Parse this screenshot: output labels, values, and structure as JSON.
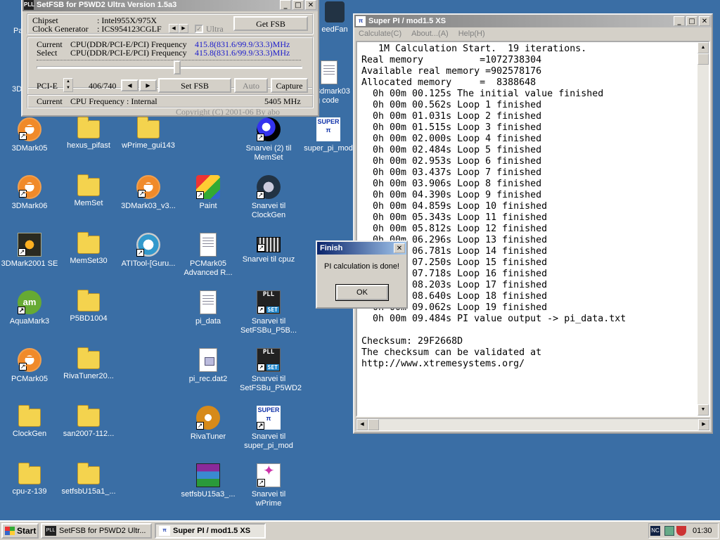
{
  "desktop": {
    "icons": [
      {
        "id": "3dmark05",
        "label": "3DMark05"
      },
      {
        "id": "hexus_pifast",
        "label": "hexus_pifast"
      },
      {
        "id": "wprime_gui143",
        "label": "wPrime_gui143"
      },
      {
        "id": "snarvei_memset",
        "label": "Snarvei (2) til MemSet"
      },
      {
        "id": "super_pi_mod",
        "label": "super_pi_mod"
      },
      {
        "id": "3dmark06",
        "label": "3DMark06"
      },
      {
        "id": "memset",
        "label": "MemSet"
      },
      {
        "id": "3dmark03_v3",
        "label": "3DMark03_v3..."
      },
      {
        "id": "paint",
        "label": "Paint"
      },
      {
        "id": "snarvei_clockgen",
        "label": "Snarvei til ClockGen"
      },
      {
        "id": "3dmark2001se",
        "label": "3DMark2001 SE"
      },
      {
        "id": "memset30",
        "label": "MemSet30"
      },
      {
        "id": "atitool",
        "label": "ATITool-[Guru..."
      },
      {
        "id": "pcmark05_adv",
        "label": "PCMark05 Advanced R..."
      },
      {
        "id": "snarvei_cpuz",
        "label": "Snarvei til cpuz"
      },
      {
        "id": "aquamark3",
        "label": "AquaMark3"
      },
      {
        "id": "p5bd1004",
        "label": "P5BD1004"
      },
      {
        "id": "pi_data",
        "label": "pi_data"
      },
      {
        "id": "snarvei_setfsbu_p5b",
        "label": "Snarvei til SetFSBu_P5B..."
      },
      {
        "id": "pcmark05",
        "label": "PCMark05"
      },
      {
        "id": "rivatuner20",
        "label": "RivaTuner20..."
      },
      {
        "id": "pi_rec_dat2",
        "label": "pi_rec.dat2"
      },
      {
        "id": "snarvei_setfsbu_p5wd2",
        "label": "Snarvei til SetFSBu_P5WD2"
      },
      {
        "id": "clockgen",
        "label": "ClockGen"
      },
      {
        "id": "san2007",
        "label": "san2007-112..."
      },
      {
        "id": "rivatuner",
        "label": "RivaTuner"
      },
      {
        "id": "snarvei_super_pi_mod",
        "label": "Snarvei til super_pi_mod"
      },
      {
        "id": "cpu_z_139",
        "label": "cpu-z-139"
      },
      {
        "id": "setfsbu15a1",
        "label": "setfsbU15a1_..."
      },
      {
        "id": "setfsbu15a3",
        "label": "setfsbU15a3_..."
      },
      {
        "id": "snarvei_wprime",
        "label": "Snarvei til wPrime"
      }
    ],
    "partial_labels": {
      "pa": "Pa",
      "3d": "3D",
      "speedfan": "eedFan",
      "3dmark03_code": "3dmark03\ng code"
    }
  },
  "setfsb": {
    "title": "SetFSB for P5WD2   Ultra Version 1.5a3",
    "chipset_label": "Chipset",
    "chipset_value": ": Intel955X/975X",
    "clockgen_label": "Clock Generator",
    "clockgen_value": ": ICS954123CGLF",
    "ultra_label": "Ultra",
    "get_fsb_label": "Get FSB",
    "current_label": "Current",
    "current_freq_label": "CPU(DDR/PCI-E/PCI) Frequency",
    "current_freq_value": "415.8(831.6/99.9/33.3)MHz",
    "select_label": "Select",
    "select_freq_label": "CPU(DDR/PCI-E/PCI) Frequency",
    "select_freq_value": "415.8(831.6/99.9/33.3)MHz",
    "slider_position": 0.53,
    "pcie_label": "PCI-E",
    "step_value": "406/740",
    "set_fsb_label": "Set FSB",
    "auto_label": "Auto",
    "capture_label": "Capture",
    "cpu_freq_label": "Current",
    "cpu_freq_source": "CPU Frequency : Internal",
    "cpu_freq_value": "5405 MHz",
    "copyright": "Copyright (C) 2001-06 By abo"
  },
  "superpi": {
    "title": "Super PI / mod1.5 XS",
    "menu": [
      "Calculate(C)",
      "About...(A)",
      "Help(H)"
    ],
    "lines": [
      "   1M Calculation Start.  19 iterations.",
      "Real memory          =1072738304",
      "Available real memory =902578176",
      "Allocated memory     =  8388648",
      "  0h 00m 00.125s The initial value finished",
      "  0h 00m 00.562s Loop 1 finished",
      "  0h 00m 01.031s Loop 2 finished",
      "  0h 00m 01.515s Loop 3 finished",
      "  0h 00m 02.000s Loop 4 finished",
      "  0h 00m 02.484s Loop 5 finished",
      "  0h 00m 02.953s Loop 6 finished",
      "  0h 00m 03.437s Loop 7 finished",
      "  0h 00m 03.906s Loop 8 finished",
      "  0h 00m 04.390s Loop 9 finished",
      "  0h 00m 04.859s Loop 10 finished",
      "  0h 00m 05.343s Loop 11 finished",
      "  0h 00m 05.812s Loop 12 finished",
      "  0h 00m 06.296s Loop 13 finished",
      "  0h 00m 06.781s Loop 14 finished",
      "  0h 00m 07.250s Loop 15 finished",
      "  0h 00m 07.718s Loop 16 finished",
      "  0h 00m 08.203s Loop 17 finished",
      "  0h 00m 08.640s Loop 18 finished",
      "  0h 00m 09.062s Loop 19 finished",
      "  0h 00m 09.484s PI value output -> pi_data.txt",
      "",
      "Checksum: 29F2668D",
      "The checksum can be validated at",
      "http://www.xtremesystems.org/"
    ]
  },
  "dialog": {
    "title": "Finish",
    "message": "PI calculation is done!",
    "ok_label": "OK"
  },
  "taskbar": {
    "start_label": "Start",
    "tasks": [
      {
        "label": "SetFSB for P5WD2   Ultr...",
        "active": false
      },
      {
        "label": "Super PI / mod1.5 XS",
        "active": true
      }
    ],
    "tray_badge": "NC",
    "clock": "01:30"
  }
}
